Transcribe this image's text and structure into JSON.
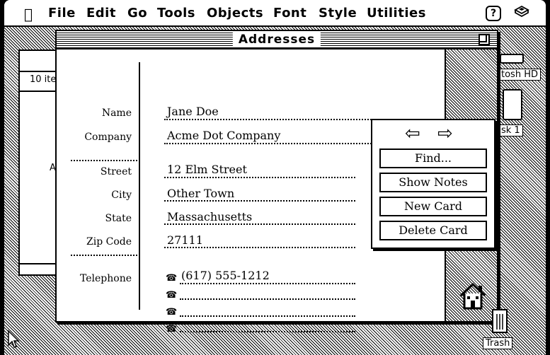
{
  "menubar": {
    "items": [
      "File",
      "Edit",
      "Go",
      "Tools",
      "Objects",
      "Font",
      "Style",
      "Utilities"
    ],
    "apple_icon": "apple-icon",
    "help_icon": "?",
    "app_icon": "hypercard-stack-icon"
  },
  "background_window": {
    "item_count": "10 ite",
    "letter": "A"
  },
  "desktop": {
    "disk1_label": "tosh HD",
    "disk2_label": "sk 1",
    "trash_label": "Trash"
  },
  "window": {
    "title": "Addresses",
    "fields": {
      "name_label": "Name",
      "name_value": "Jane Doe",
      "company_label": "Company",
      "company_value": "Acme Dot Company",
      "street_label": "Street",
      "street_value": "12 Elm Street",
      "city_label": "City",
      "city_value": "Other Town",
      "state_label": "State",
      "state_value": "Massachusetts",
      "zip_label": "Zip Code",
      "zip_value": "27111",
      "telephone_label": "Telephone",
      "phones": [
        "(617) 555-1212",
        "",
        "",
        ""
      ]
    }
  },
  "palette": {
    "prev_arrow": "⇦",
    "next_arrow": "⇨",
    "find": "Find...",
    "show_notes": "Show Notes",
    "new_card": "New Card",
    "delete_card": "Delete Card"
  }
}
